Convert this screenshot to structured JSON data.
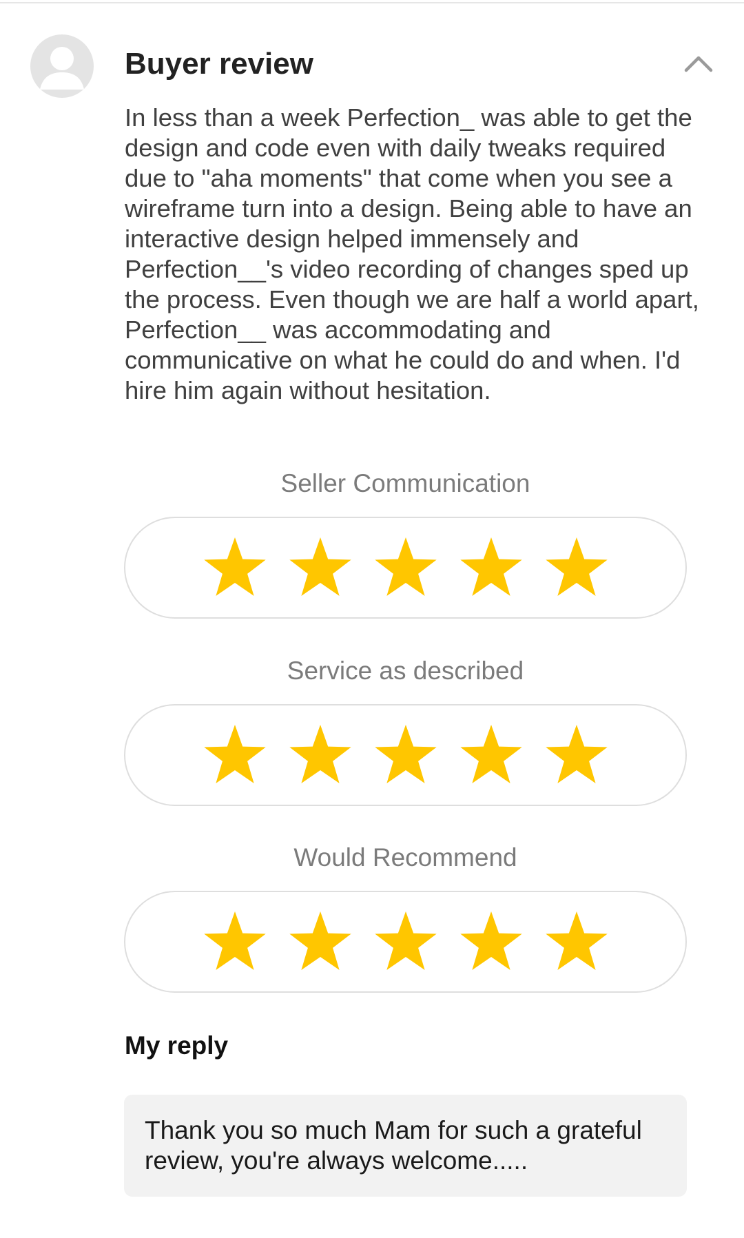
{
  "review": {
    "title": "Buyer review",
    "text": "In less than a week Perfection_ was able to get the design and code even with daily tweaks required due to \"aha moments\" that come when you see a wireframe turn into a design. Being able to have an interactive design helped immensely and Perfection__'s video recording of changes sped up the process. Even though we are half a world apart, Perfection__ was accommodating and communicative on what he could do and when. I'd hire him again without hesitation."
  },
  "ratings": [
    {
      "label": "Seller Communication",
      "stars": 5,
      "max_stars": 5
    },
    {
      "label": "Service as described",
      "stars": 5,
      "max_stars": 5
    },
    {
      "label": "Would Recommend",
      "stars": 5,
      "max_stars": 5
    }
  ],
  "reply": {
    "title": "My reply",
    "text": "Thank you so much Mam for such a grateful review, you're always welcome....."
  },
  "icons": {
    "avatar": "user-avatar-icon",
    "collapse": "chevron-up-icon",
    "star": "star-icon"
  },
  "colors": {
    "star": "#FFC600",
    "label": "#7b7b7b",
    "reply_background": "#f2f2f2"
  }
}
